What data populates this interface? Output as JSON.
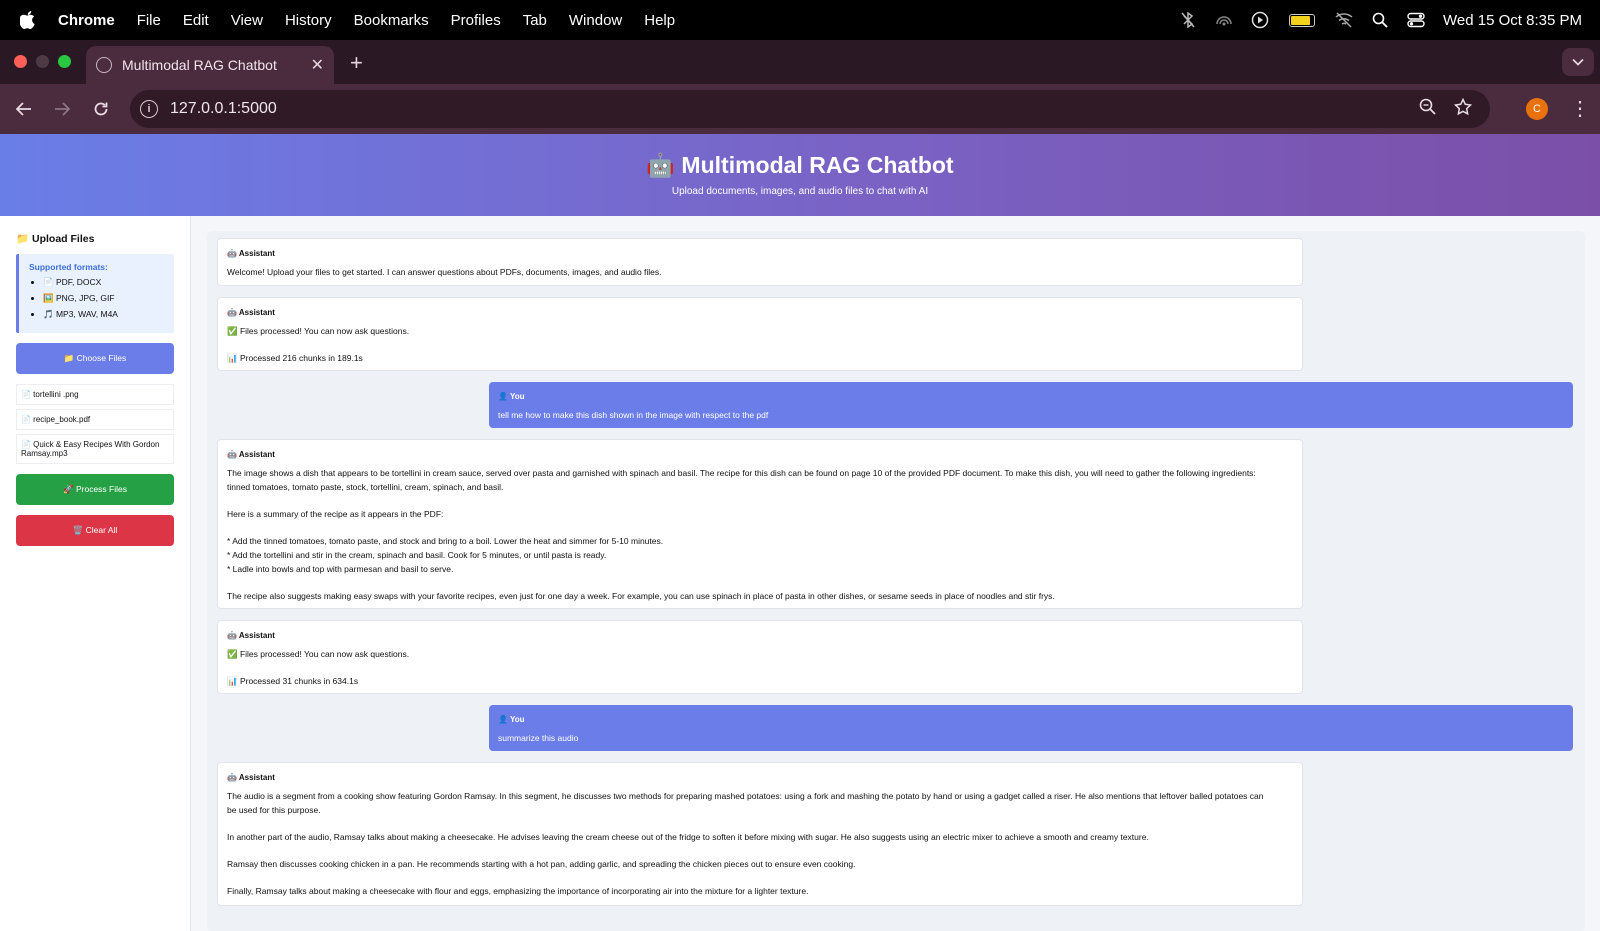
{
  "menubar": {
    "app": "Chrome",
    "items": [
      "File",
      "Edit",
      "View",
      "History",
      "Bookmarks",
      "Profiles",
      "Tab",
      "Window",
      "Help"
    ],
    "clock": "Wed 15 Oct  8:35 PM"
  },
  "browser": {
    "tab_title": "Multimodal RAG Chatbot",
    "url": "127.0.0.1:5000",
    "avatar_letter": "C"
  },
  "header": {
    "title": "🤖 Multimodal RAG Chatbot",
    "subtitle": "Upload documents, images, and audio files to chat with AI"
  },
  "sidebar": {
    "title": "📁 Upload Files",
    "formats_title": "Supported formats:",
    "formats": [
      "📄 PDF, DOCX",
      "🖼️ PNG, JPG, GIF",
      "🎵 MP3, WAV, M4A"
    ],
    "choose_label": "📁 Choose Files",
    "files": [
      "📄 tortellini .png",
      "📄 recipe_book.pdf",
      "📄 Quick & Easy Recipes With Gordon Ramsay.mp3"
    ],
    "process_label": "🚀 Process Files",
    "clear_label": "🗑️ Clear All"
  },
  "chat": {
    "messages": [
      {
        "role": "assistant",
        "who": "🤖 Assistant",
        "lines": [
          "Welcome! Upload your files to get started. I can answer questions about PDFs, documents, images, and audio files."
        ]
      },
      {
        "role": "assistant",
        "who": "🤖 Assistant",
        "lines": [
          "✅ Files processed! You can now ask questions.",
          "",
          "📊 Processed 216 chunks in 189.1s"
        ]
      },
      {
        "role": "user",
        "who": "👤 You",
        "lines": [
          "tell me how to make this dish shown in the image with respect to the pdf"
        ]
      },
      {
        "role": "assistant",
        "who": "🤖 Assistant",
        "lines": [
          "The image shows a dish that appears to be tortellini in cream sauce, served over pasta and garnished with spinach and basil. The recipe for this dish can be found on page 10 of the provided PDF document. To make this dish, you will need to gather the following ingredients:",
          "tinned tomatoes, tomato paste, stock, tortellini, cream, spinach, and basil.",
          "",
          "Here is a summary of the recipe as it appears in the PDF:",
          "",
          "* Add the tinned tomatoes, tomato paste, and stock and bring to a boil. Lower the heat and simmer for 5-10 minutes.",
          "* Add the tortellini and stir in the cream, spinach and basil. Cook for 5 minutes, or until pasta is ready.",
          "* Ladle into bowls and top with parmesan and basil to serve.",
          "",
          "The recipe also suggests making easy swaps with your favorite recipes, even just for one day a week. For example, you can use spinach in place of pasta in other dishes, or sesame seeds in place of noodles and stir frys."
        ]
      },
      {
        "role": "assistant",
        "who": "🤖 Assistant",
        "lines": [
          "✅ Files processed! You can now ask questions.",
          "",
          "📊 Processed 31 chunks in 634.1s"
        ]
      },
      {
        "role": "user",
        "who": "👤 You",
        "lines": [
          "summarize this audio"
        ]
      },
      {
        "role": "assistant",
        "who": "🤖 Assistant",
        "lines": [
          "The audio is a segment from a cooking show featuring Gordon Ramsay. In this segment, he discusses two methods for preparing mashed potatoes: using a fork and mashing the potato by hand or using a gadget called a riser. He also mentions that leftover balled potatoes can",
          "be used for this purpose.",
          "",
          "In another part of the audio, Ramsay talks about making a cheesecake. He advises leaving the cream cheese out of the fridge to soften it before mixing with sugar. He also suggests using an electric mixer to achieve a smooth and creamy texture.",
          "",
          "Ramsay then discusses cooking chicken in a pan. He recommends starting with a hot pan, adding garlic, and spreading the chicken pieces out to ensure even cooking.",
          "",
          "Finally, Ramsay talks about making a cheesecake with flour and eggs, emphasizing the importance of incorporating air into the mixture for a lighter texture."
        ]
      }
    ]
  }
}
